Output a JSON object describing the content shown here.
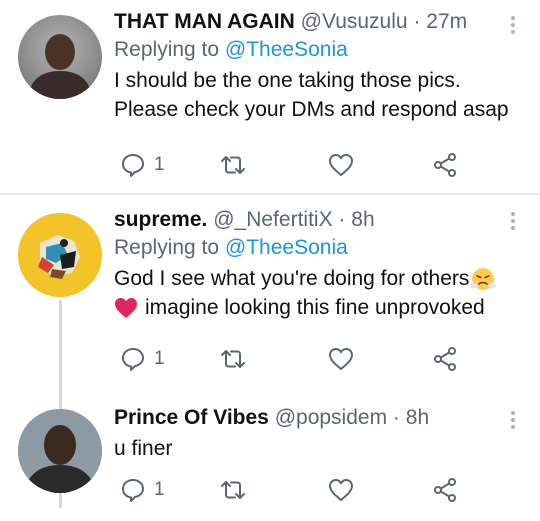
{
  "tweets": [
    {
      "name": "THAT MAN AGAIN",
      "handle": "@Vusuzulu",
      "separator": "·",
      "time": "27m",
      "replying_prefix": "Replying to ",
      "replying_to": "@TheeSonia",
      "lines": [
        "I should be the one taking those pics.",
        "Please check your DMs and respond asap"
      ],
      "reply_count": "1"
    },
    {
      "name": "supreme.",
      "handle": "@_NefertitiX",
      "separator": "·",
      "time": "8h",
      "replying_prefix": "Replying to ",
      "replying_to": "@TheeSonia",
      "lines": [
        "God I see what you're doing for others",
        "imagine looking this fine unprovoked"
      ],
      "reply_count": "1"
    },
    {
      "name": "Prince Of Vibes",
      "handle": "@popsidem",
      "separator": "·",
      "time": "8h",
      "lines": [
        "u finer"
      ],
      "reply_count": "1"
    }
  ],
  "icons": [
    "reply-icon",
    "retweet-icon",
    "like-icon",
    "share-icon",
    "more-icon"
  ],
  "colors": {
    "link": "#1b95e0",
    "secondary": "#5b6670",
    "heart_emoji": "#e0245e",
    "thread_line": "#cfd9de"
  }
}
